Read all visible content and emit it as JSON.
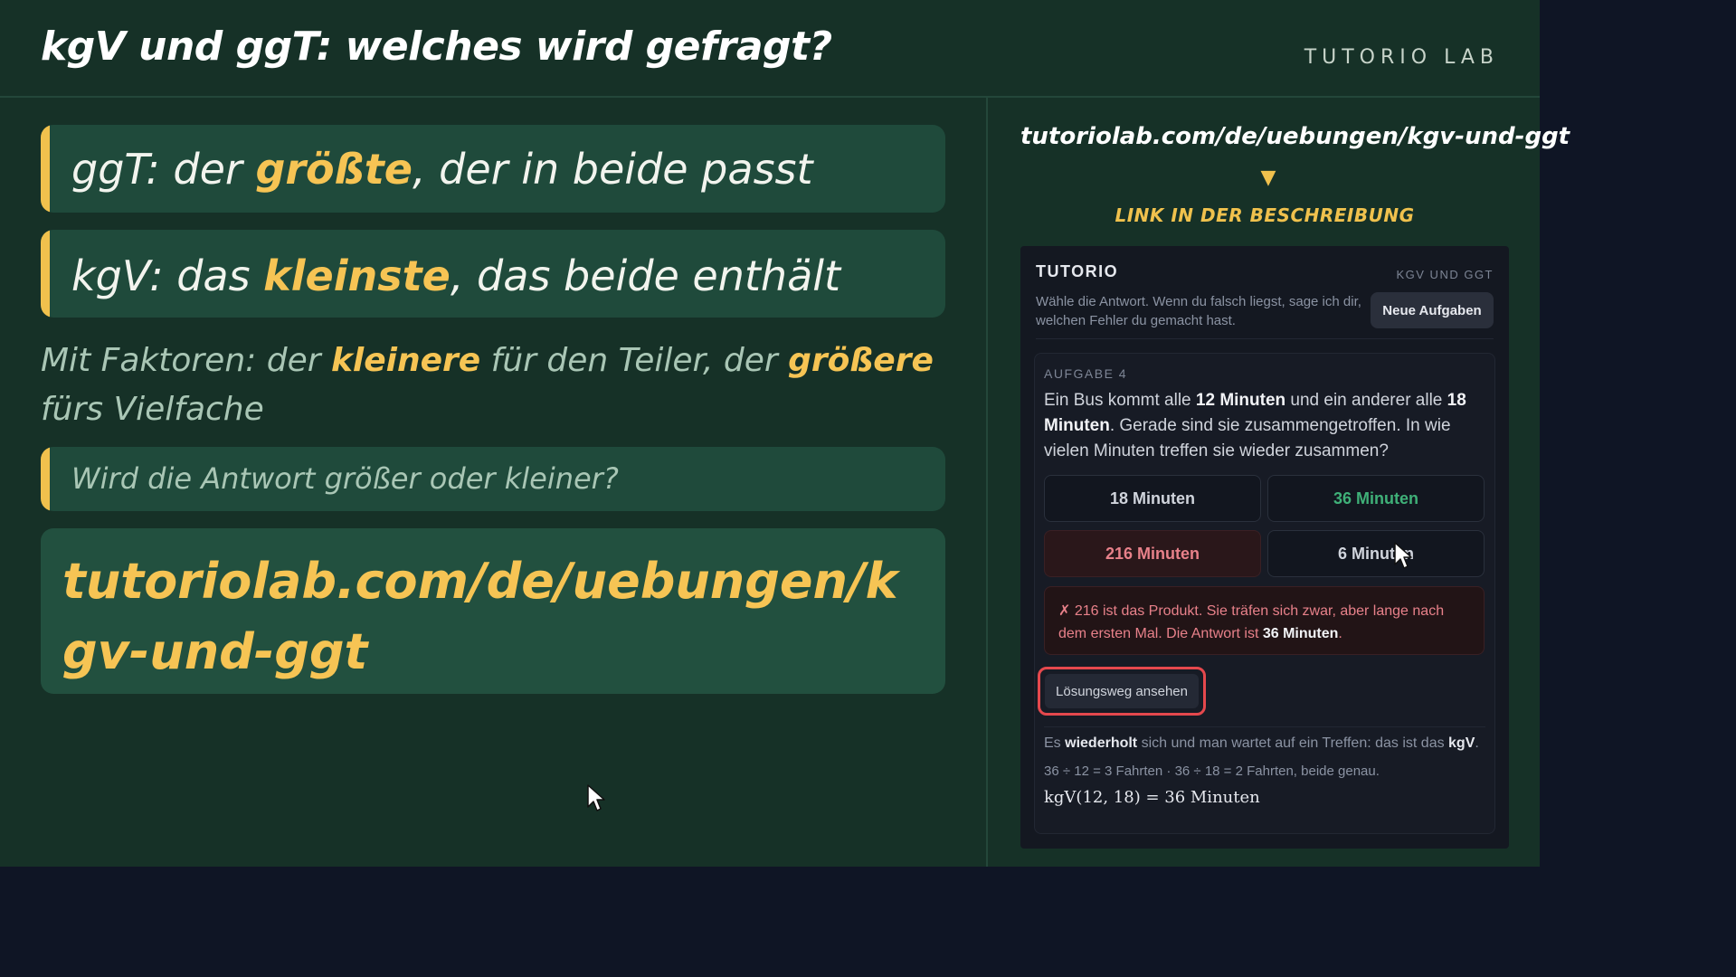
{
  "header": {
    "title": "kgV und ggT: welches wird gefragt?",
    "brand": "TUTORIO LAB"
  },
  "cards": {
    "ggt": {
      "prefix": "ggT: der ",
      "highlight": "größte",
      "suffix": ", der in beide passt"
    },
    "kgv": {
      "prefix": "kgV: das ",
      "highlight": "kleinste",
      "suffix": ", das beide enthält"
    },
    "factors": {
      "part1": "Mit Faktoren: der ",
      "hl1": "kleinere",
      "part2": " für den Teiler, der ",
      "hl2": "größere",
      "part3": " fürs Vielfache"
    },
    "question": "Wird die Antwort größer oder kleiner?",
    "url": "tutoriolab.com/de/uebungen/kgv-und-ggt"
  },
  "link": {
    "url": "tutoriolab.com/de/uebungen/kgv-und-ggt",
    "arrow": "▼",
    "cta": "LINK IN DER BESCHREIBUNG"
  },
  "app": {
    "brand": "TUTORIO",
    "topic": "KGV UND GGT",
    "subtitle": "Wähle die Antwort. Wenn du falsch liegst, sage ich dir, welchen Fehler du gemacht hast.",
    "new_tasks_button": "Neue Aufgaben",
    "task": {
      "label": "AUFGABE 4",
      "q1": "Ein Bus kommt alle ",
      "q_b1": "12 Minuten",
      "q2": " und ein anderer alle ",
      "q_b2": "18 Minuten",
      "q3": ". Gerade sind sie zusammengetroffen. In wie vielen Minuten treffen sie wieder zusammen?",
      "options": [
        "18 Minuten",
        "36 Minuten",
        "216 Minuten",
        "6 Minuten"
      ],
      "feedback_text": "✗ 216 ist das Produkt. Sie träfen sich zwar, aber lange nach dem ersten Mal. Die Antwort ist ",
      "feedback_answer": "36 Minuten",
      "feedback_end": ".",
      "solution_button": "Lösungsweg ansehen",
      "solution": {
        "s1a": "Es ",
        "s1b": "wiederholt",
        "s1c": " sich und man wartet auf ein Treffen: das ist das ",
        "s1d": "kgV",
        "s1e": ".",
        "line2": "36 ÷ 12 = 3 Fahrten  ·  36 ÷ 18 = 2 Fahrten, beide genau.",
        "line3": "kgV(12, 18) = 36 Minuten"
      }
    }
  },
  "colors": {
    "board": "#163127",
    "card": "#1f4a3b",
    "accent": "#f0c14d",
    "highlight": "#f6c454",
    "correct": "#3fb078",
    "wrong": "#e8818a",
    "focus_ring": "#e5484d"
  }
}
